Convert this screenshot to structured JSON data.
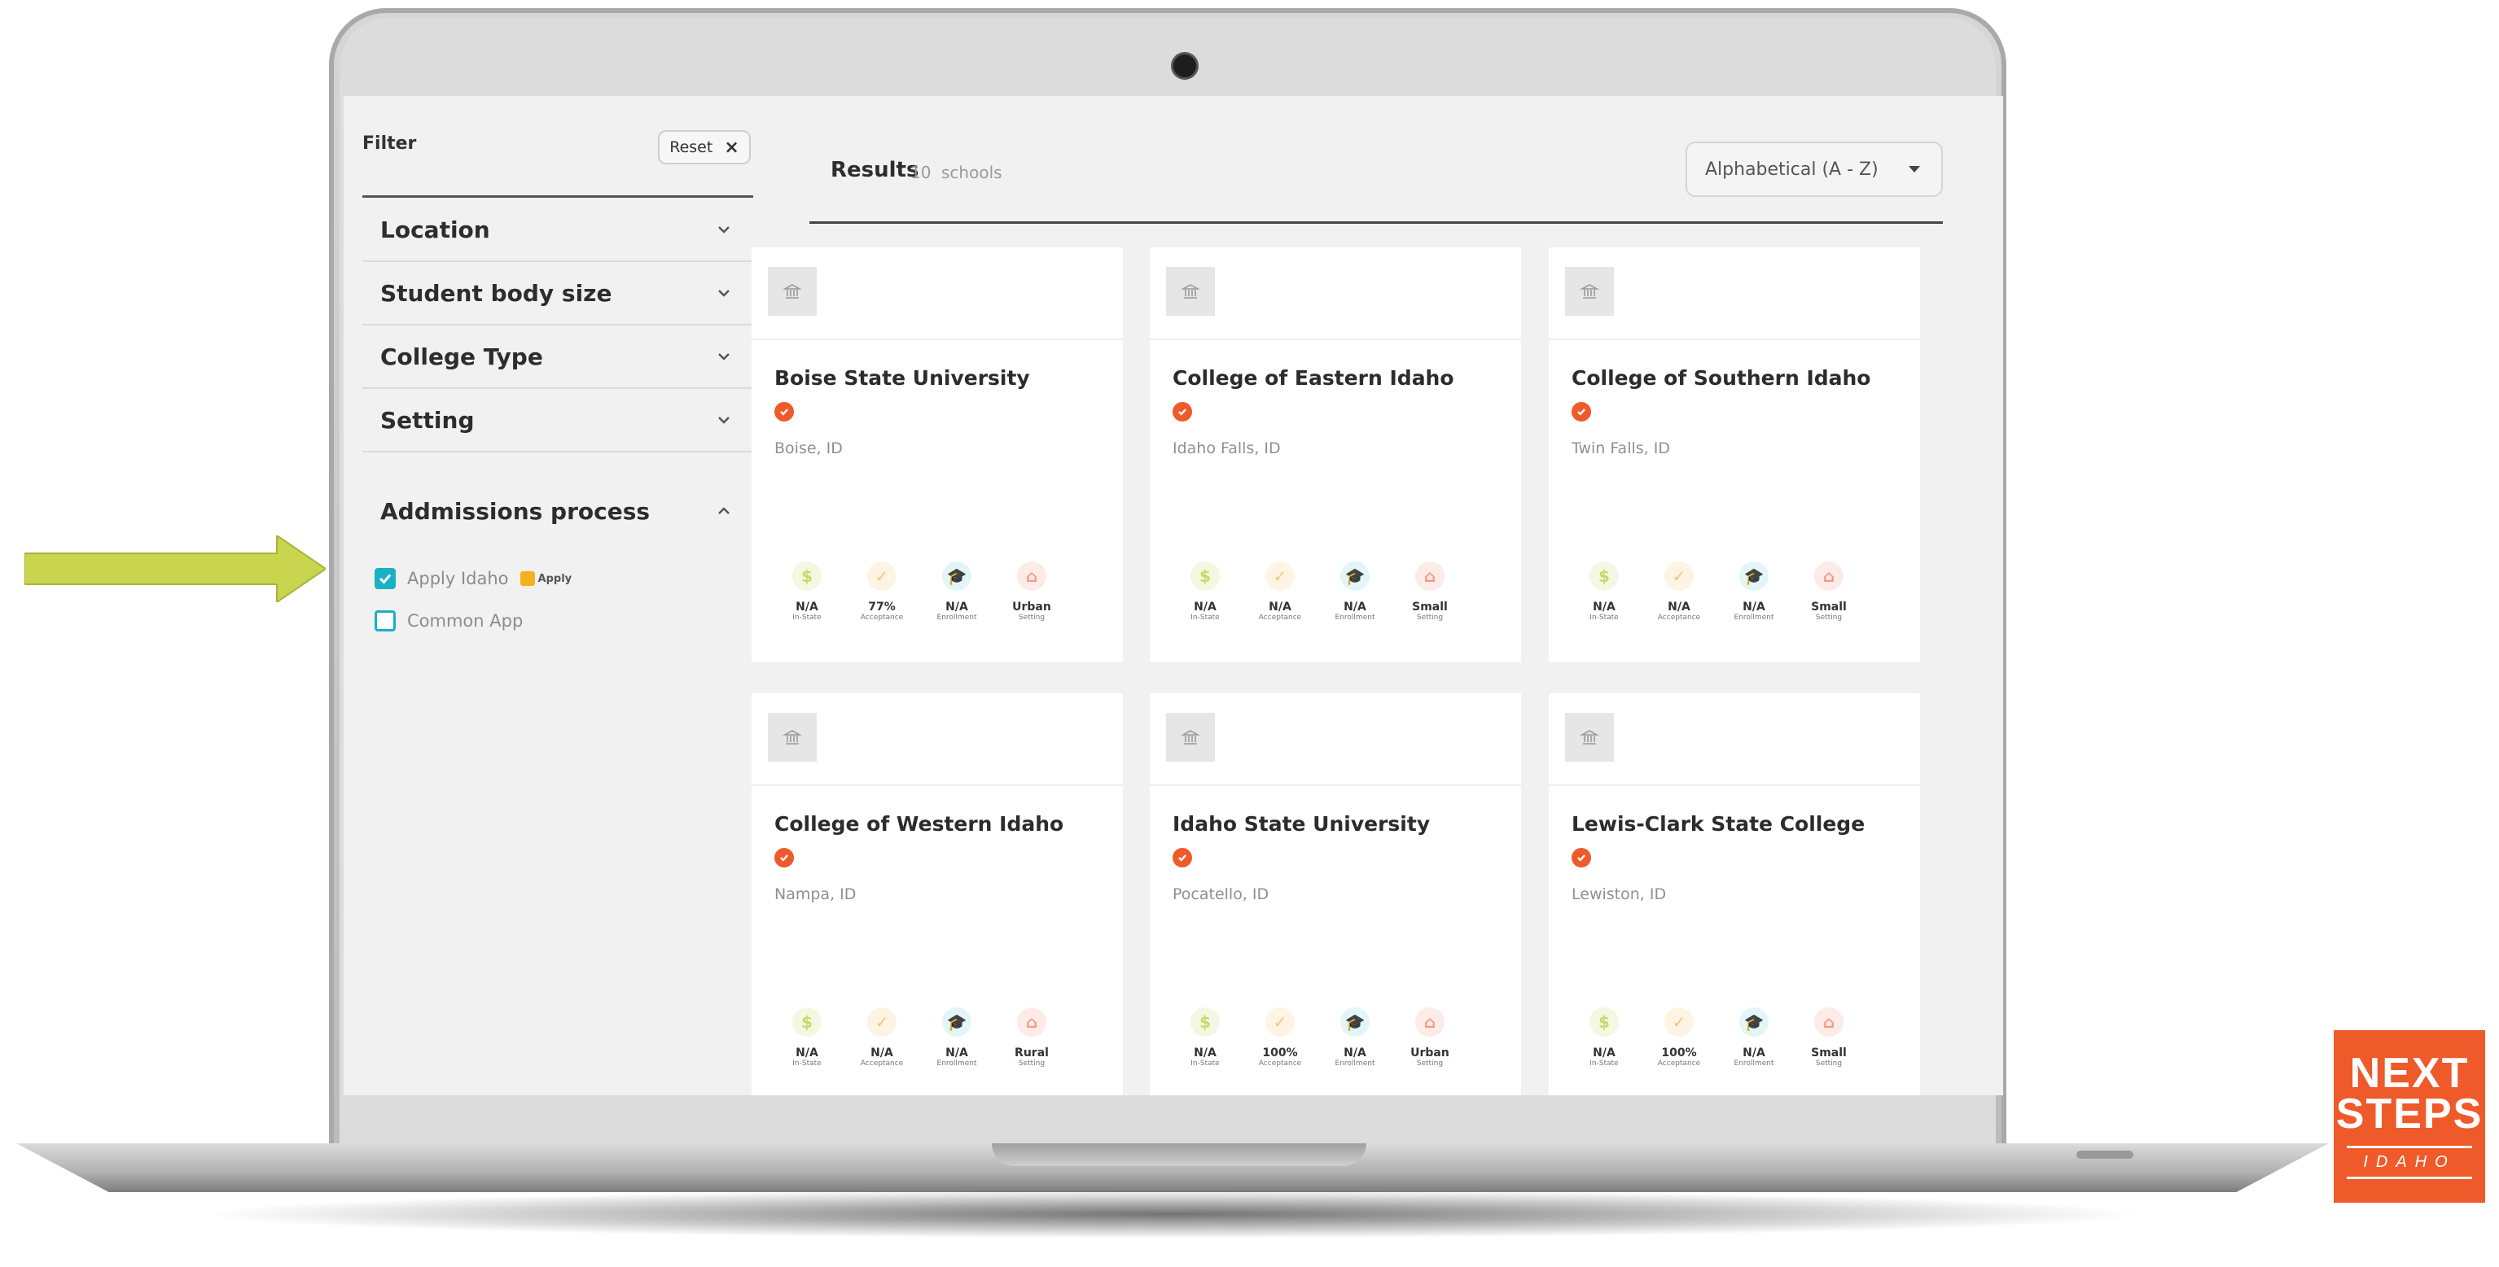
{
  "filter": {
    "title": "Filter",
    "reset_label": "Reset",
    "reset_icon": "close-icon",
    "sections": [
      {
        "label": "Location"
      },
      {
        "label": "Student body size"
      },
      {
        "label": "College Type"
      },
      {
        "label": "Setting"
      }
    ],
    "admissions": {
      "label": "Addmissions process",
      "options": [
        {
          "label": "Apply Idaho",
          "checked": true,
          "badge": "Apply"
        },
        {
          "label": "Common App",
          "checked": false
        }
      ]
    }
  },
  "results": {
    "title": "Results",
    "count": "10",
    "unit": "schools",
    "sort_value": "Alphabetical (A - Z)"
  },
  "stat_labels": [
    "In-State",
    "Acceptance",
    "Enrollment",
    "Setting"
  ],
  "stat_colors": {
    "tuition": "#c9d96a",
    "acceptance": "#f5c67a",
    "enrollment": "#6fd0dc",
    "setting": "#f39a86"
  },
  "cards": [
    {
      "name": "Boise State University",
      "location": "Boise, ID",
      "stats": [
        "N/A",
        "77%",
        "N/A",
        "Urban"
      ]
    },
    {
      "name": "College of Eastern Idaho",
      "location": "Idaho Falls, ID",
      "stats": [
        "N/A",
        "N/A",
        "N/A",
        "Small"
      ]
    },
    {
      "name": "College of Southern Idaho",
      "location": "Twin Falls, ID",
      "stats": [
        "N/A",
        "N/A",
        "N/A",
        "Small"
      ]
    },
    {
      "name": "College of Western Idaho",
      "location": "Nampa, ID",
      "stats": [
        "N/A",
        "N/A",
        "N/A",
        "Rural"
      ]
    },
    {
      "name": "Idaho State University",
      "location": "Pocatello, ID",
      "stats": [
        "N/A",
        "100%",
        "N/A",
        "Urban"
      ]
    },
    {
      "name": "Lewis-Clark State College",
      "location": "Lewiston, ID",
      "stats": [
        "N/A",
        "100%",
        "N/A",
        "Small"
      ]
    }
  ],
  "brand": {
    "line1": "NEXT",
    "line2": "STEPS",
    "line3": "IDAHO",
    "color": "#ef5a2a"
  },
  "accent": "#19b2c4",
  "arrow_color": "#c9d44f"
}
